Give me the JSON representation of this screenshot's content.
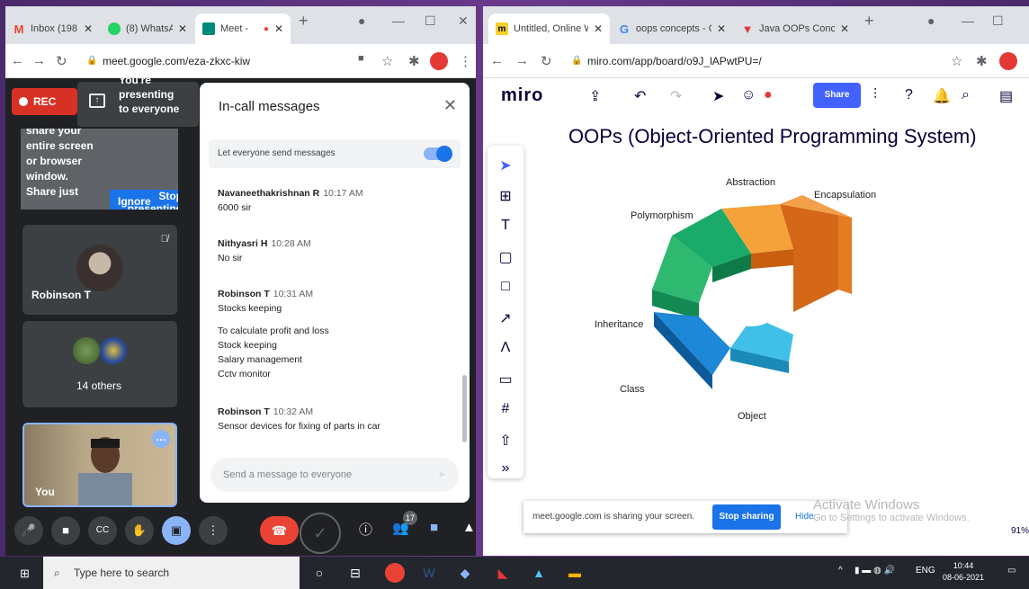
{
  "left_browser": {
    "tabs": [
      {
        "label": "Inbox (198",
        "icon": "gmail-icon",
        "color": "#ea4335"
      },
      {
        "label": "(8) WhatsA",
        "icon": "whatsapp-icon",
        "color": "#25d366"
      },
      {
        "label": "Meet -",
        "icon": "meet-icon",
        "color": "#00897b",
        "active": true
      }
    ],
    "url": "meet.google.com/eza-zkxc-kiw"
  },
  "meet": {
    "rec_label": "REC",
    "presenting_label": "You're presenting to everyone",
    "share_prompt": "share your entire screen or browser window. Share just",
    "stop_presenting": "Stop presenting",
    "ignore": "Ignore",
    "participants": [
      {
        "name": "Robinson T"
      },
      {
        "name": "14 others"
      },
      {
        "name": "You"
      }
    ],
    "participant_count": "17"
  },
  "chat": {
    "title": "In-call messages",
    "toggle_label": "Let everyone send messages",
    "messages": [
      {
        "sender": "Navaneethakrishnan R",
        "time": "10:17 AM",
        "lines": [
          "6000 sir"
        ]
      },
      {
        "sender": "Nithyasri H",
        "time": "10:28 AM",
        "lines": [
          "No sir"
        ]
      },
      {
        "sender": "Robinson T",
        "time": "10:31 AM",
        "lines": [
          "Stocks keeping",
          "",
          "To calculate profit and loss",
          "Stock keeping",
          "Salary management",
          "Cctv monitor"
        ]
      },
      {
        "sender": "Robinson T",
        "time": "10:32 AM",
        "lines": [
          "Sensor devices for fixing of parts in car"
        ]
      }
    ],
    "input_placeholder": "Send a message to everyone"
  },
  "right_browser": {
    "tabs": [
      {
        "label": "Untitled, Online W",
        "icon": "miro-icon",
        "color": "#f5d128",
        "active": true
      },
      {
        "label": "oops concepts - G",
        "icon": "google-icon",
        "color": "#4285f4"
      },
      {
        "label": "Java OOPs Concep",
        "icon": "javatpoint-icon",
        "color": "#e53935"
      }
    ],
    "url": "miro.com/app/board/o9J_lAPwtPU=/"
  },
  "miro": {
    "logo": "miro",
    "share_label": "Share",
    "board_title": "OOPs (Object-Oriented Programming System)",
    "diagram_labels": {
      "abstraction": "Abstraction",
      "encapsulation": "Encapsulation",
      "polymorphism": "Polymorphism",
      "inheritance": "Inheritance",
      "class": "Class",
      "object": "Object"
    },
    "sharing_notice": "meet.google.com is sharing your screen.",
    "stop_sharing": "Stop sharing",
    "hide": "Hide",
    "watermark_title": "Activate Windows",
    "watermark_sub": "Go to Settings to activate Windows.",
    "zoom": "91%"
  },
  "taskbar": {
    "search_placeholder": "Type here to search",
    "lang": "ENG",
    "time": "10:44",
    "date": "08-06-2021"
  }
}
